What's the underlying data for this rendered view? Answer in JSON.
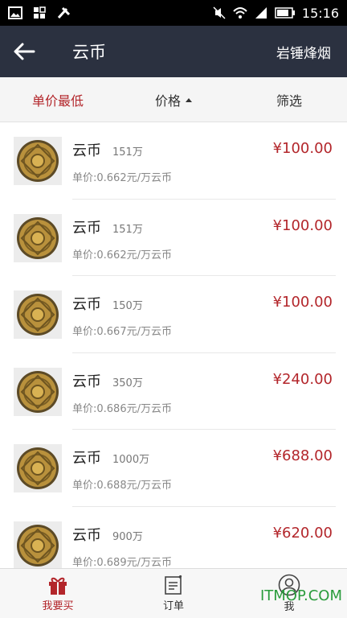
{
  "status_bar": {
    "time": "15:16"
  },
  "title_bar": {
    "title": "云币",
    "server": "岩锤烽烟"
  },
  "sort_bar": {
    "lowest_unit_price": "单价最低",
    "price": "价格",
    "filter": "筛选"
  },
  "listings": [
    {
      "name": "云币",
      "amount": "151万",
      "unit_price": "单价:0.662元/万云币",
      "price": "¥100.00"
    },
    {
      "name": "云币",
      "amount": "151万",
      "unit_price": "单价:0.662元/万云币",
      "price": "¥100.00"
    },
    {
      "name": "云币",
      "amount": "150万",
      "unit_price": "单价:0.667元/万云币",
      "price": "¥100.00"
    },
    {
      "name": "云币",
      "amount": "350万",
      "unit_price": "单价:0.686元/万云币",
      "price": "¥240.00"
    },
    {
      "name": "云币",
      "amount": "1000万",
      "unit_price": "单价:0.688元/万云币",
      "price": "¥688.00"
    },
    {
      "name": "云币",
      "amount": "900万",
      "unit_price": "单价:0.689元/万云币",
      "price": "¥620.00"
    }
  ],
  "bottom_nav": {
    "buy": "我要买",
    "orders": "订单",
    "me": "我"
  },
  "watermark": "ITMOP.COM",
  "colors": {
    "accent": "#b3262b",
    "title_bar": "#2b3140"
  }
}
